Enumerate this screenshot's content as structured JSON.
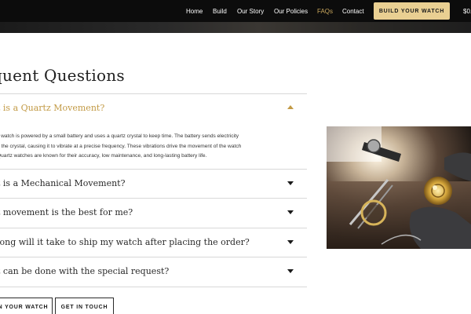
{
  "nav": {
    "items": [
      {
        "label": "Home",
        "active": false
      },
      {
        "label": "Build",
        "active": false
      },
      {
        "label": "Our Story",
        "active": false
      },
      {
        "label": "Our Policies",
        "active": false
      },
      {
        "label": "FAQs",
        "active": true
      },
      {
        "label": "Contact",
        "active": false
      }
    ],
    "cta_label": "BUILD YOUR WATCH",
    "cart_text": "$0."
  },
  "page": {
    "heading": "quent Questions"
  },
  "faq": [
    {
      "question": "t is a Quartz Movement?",
      "expanded": true,
      "answer_lines": [
        "z watch is powered by a small battery and uses a quartz crystal to keep time. The battery sends electricity",
        "h the crystal, causing it to vibrate at a precise frequency. These vibrations drive the movement of the watch",
        "Quartz watches are known for their accuracy, low maintenance, and long-lasting battery life."
      ]
    },
    {
      "question": "t is a Mechanical Movement?",
      "expanded": false
    },
    {
      "question": "t movement is the best for me?",
      "expanded": false
    },
    {
      "question": "long will it take to ship my watch after placing the order?",
      "expanded": false
    },
    {
      "question": "t can be done with the special request?",
      "expanded": false
    }
  ],
  "buttons": {
    "build_label": "N YOUR WATCH",
    "contact_label": "GET IN TOUCH"
  },
  "colors": {
    "accent_gold": "#c29a45",
    "cta_background": "#e9cf92",
    "nav_background": "#0c0c0c"
  },
  "image": {
    "icon": "watchmaker-photo"
  }
}
